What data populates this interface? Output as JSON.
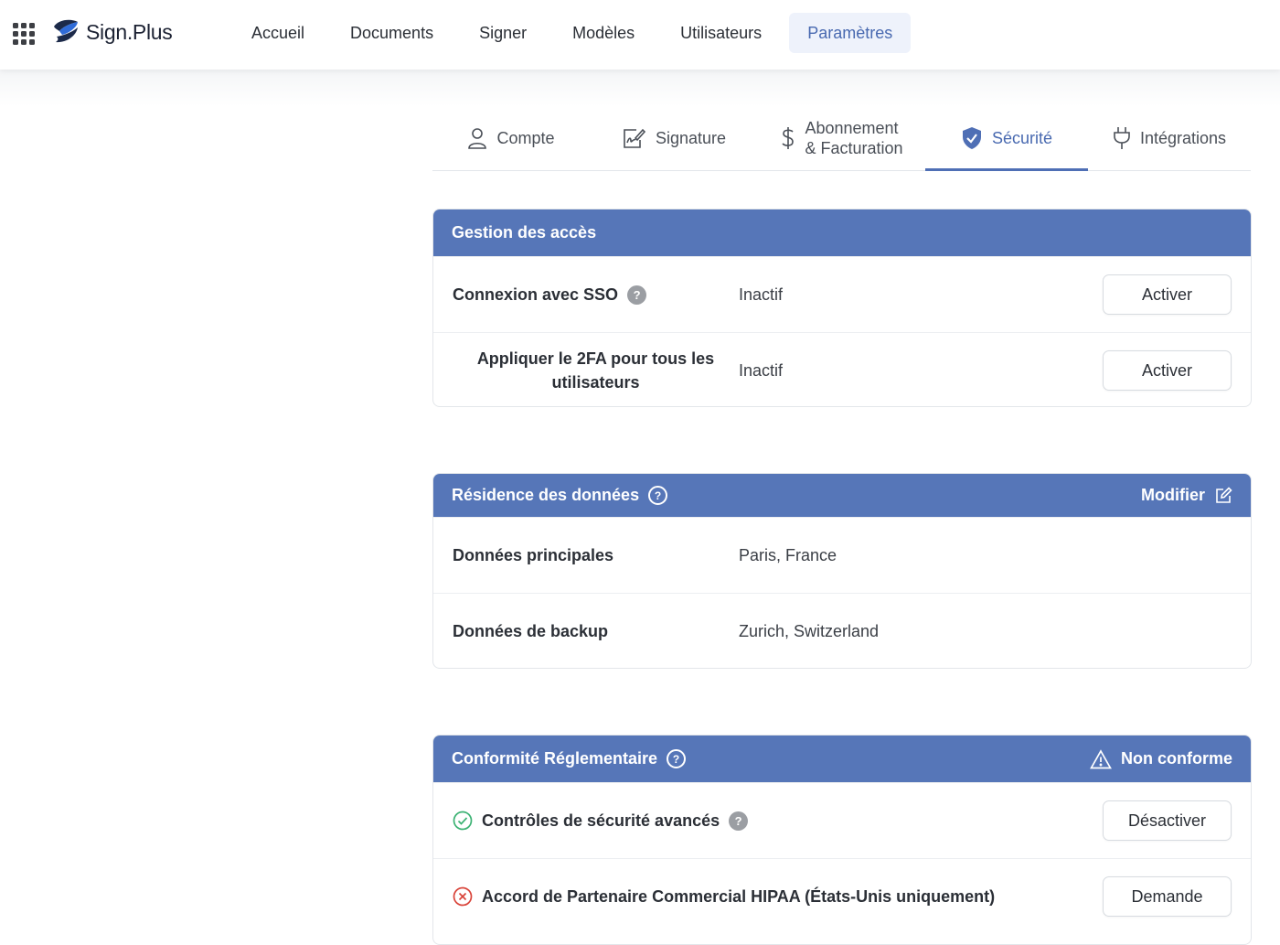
{
  "brand": {
    "name": "Sign.Plus"
  },
  "nav": {
    "items": [
      {
        "label": "Accueil",
        "active": false
      },
      {
        "label": "Documents",
        "active": false
      },
      {
        "label": "Signer",
        "active": false
      },
      {
        "label": "Modèles",
        "active": false
      },
      {
        "label": "Utilisateurs",
        "active": false
      },
      {
        "label": "Paramètres",
        "active": true
      }
    ]
  },
  "tabs": [
    {
      "label": "Compte",
      "icon": "user-icon"
    },
    {
      "label": "Signature",
      "icon": "signature-icon"
    },
    {
      "label_line1": "Abonnement",
      "label_line2": "& Facturation",
      "icon": "dollar-icon"
    },
    {
      "label": "Sécurité",
      "icon": "shield-check-icon",
      "active": true
    },
    {
      "label": "Intégrations",
      "icon": "plug-icon"
    }
  ],
  "access": {
    "title": "Gestion des accès",
    "rows": [
      {
        "label": "Connexion avec SSO",
        "value": "Inactif",
        "button": "Activer"
      },
      {
        "label": "Appliquer le 2FA pour tous les utilisateurs",
        "value": "Inactif",
        "button": "Activer"
      }
    ]
  },
  "residence": {
    "title": "Résidence des données",
    "edit_label": "Modifier",
    "rows": [
      {
        "label": "Données principales",
        "value": "Paris, France"
      },
      {
        "label": "Données de backup",
        "value": "Zurich, Switzerland"
      }
    ]
  },
  "compliance": {
    "title": "Conformité Réglementaire",
    "status": "Non conforme",
    "rows": [
      {
        "label": "Contrôles de sécurité avancés",
        "status": "ok",
        "button": "Désactiver"
      },
      {
        "label": "Accord de Partenaire Commercial HIPAA (États-Unis uniquement)",
        "status": "error",
        "button": "Demande"
      }
    ]
  },
  "colors": {
    "accent": "#5676b8",
    "active_text": "#4869b0",
    "ok": "#3bb273",
    "error": "#d9443a"
  }
}
